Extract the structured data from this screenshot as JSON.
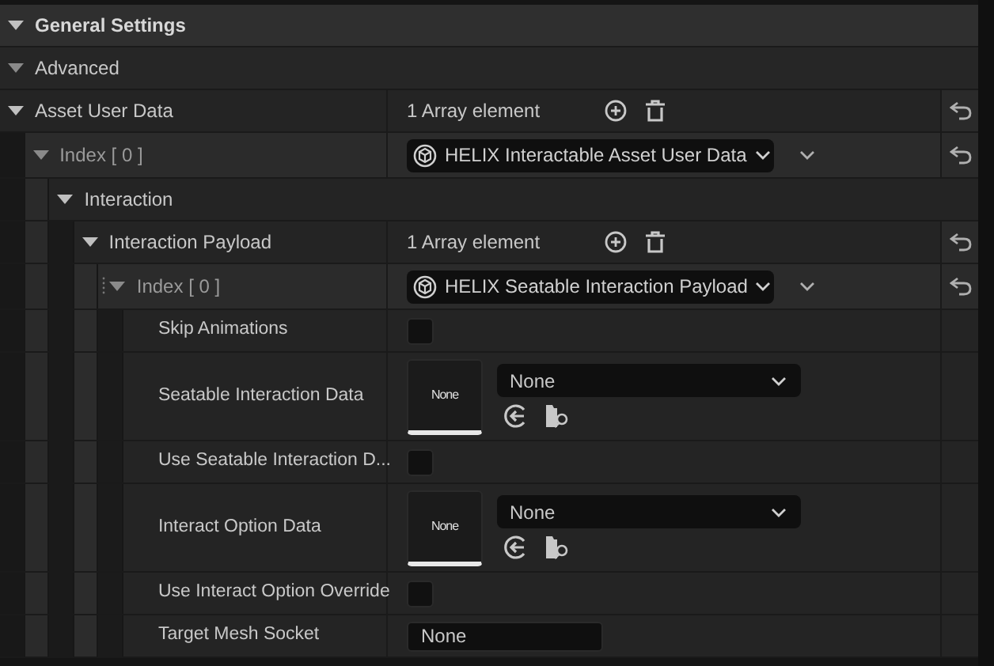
{
  "categories": [
    {
      "label": "General Settings",
      "kind": "header",
      "expanded": true
    },
    {
      "label": "Advanced",
      "kind": "subheader",
      "expanded": true
    }
  ],
  "properties": [
    {
      "label": "Asset User Data",
      "kind": "array",
      "value": "1 Array element",
      "expanded": true,
      "children": [
        {
          "label": "Index [ 0 ]",
          "kind": "instance",
          "value": "HELIX Interactable Asset User Data",
          "expanded": true,
          "draggable": false,
          "children": [
            {
              "label": "Interaction",
              "kind": "group",
              "expanded": true,
              "children": [
                {
                  "label": "Interaction Payload",
                  "kind": "array",
                  "value": "1 Array element",
                  "expanded": true,
                  "children": [
                    {
                      "label": "Index [ 0 ]",
                      "kind": "instance",
                      "value": "HELIX Seatable Interaction Payload",
                      "expanded": true,
                      "draggable": true,
                      "children": [
                        {
                          "label": "Skip Animations",
                          "kind": "checkbox",
                          "checked": false
                        },
                        {
                          "label": "Seatable Interaction Data",
                          "kind": "asset",
                          "thumbnail": "None",
                          "value": "None"
                        },
                        {
                          "label": "Use Seatable Interaction D...",
                          "kind": "checkbox",
                          "checked": false
                        },
                        {
                          "label": "Interact Option Data",
                          "kind": "asset",
                          "thumbnail": "None",
                          "value": "None"
                        },
                        {
                          "label": "Use Interact Option Override",
                          "kind": "checkbox",
                          "checked": false
                        },
                        {
                          "label": "Target Mesh Socket",
                          "kind": "text",
                          "value": "None"
                        }
                      ]
                    }
                  ]
                }
              ]
            }
          ]
        }
      ]
    }
  ]
}
